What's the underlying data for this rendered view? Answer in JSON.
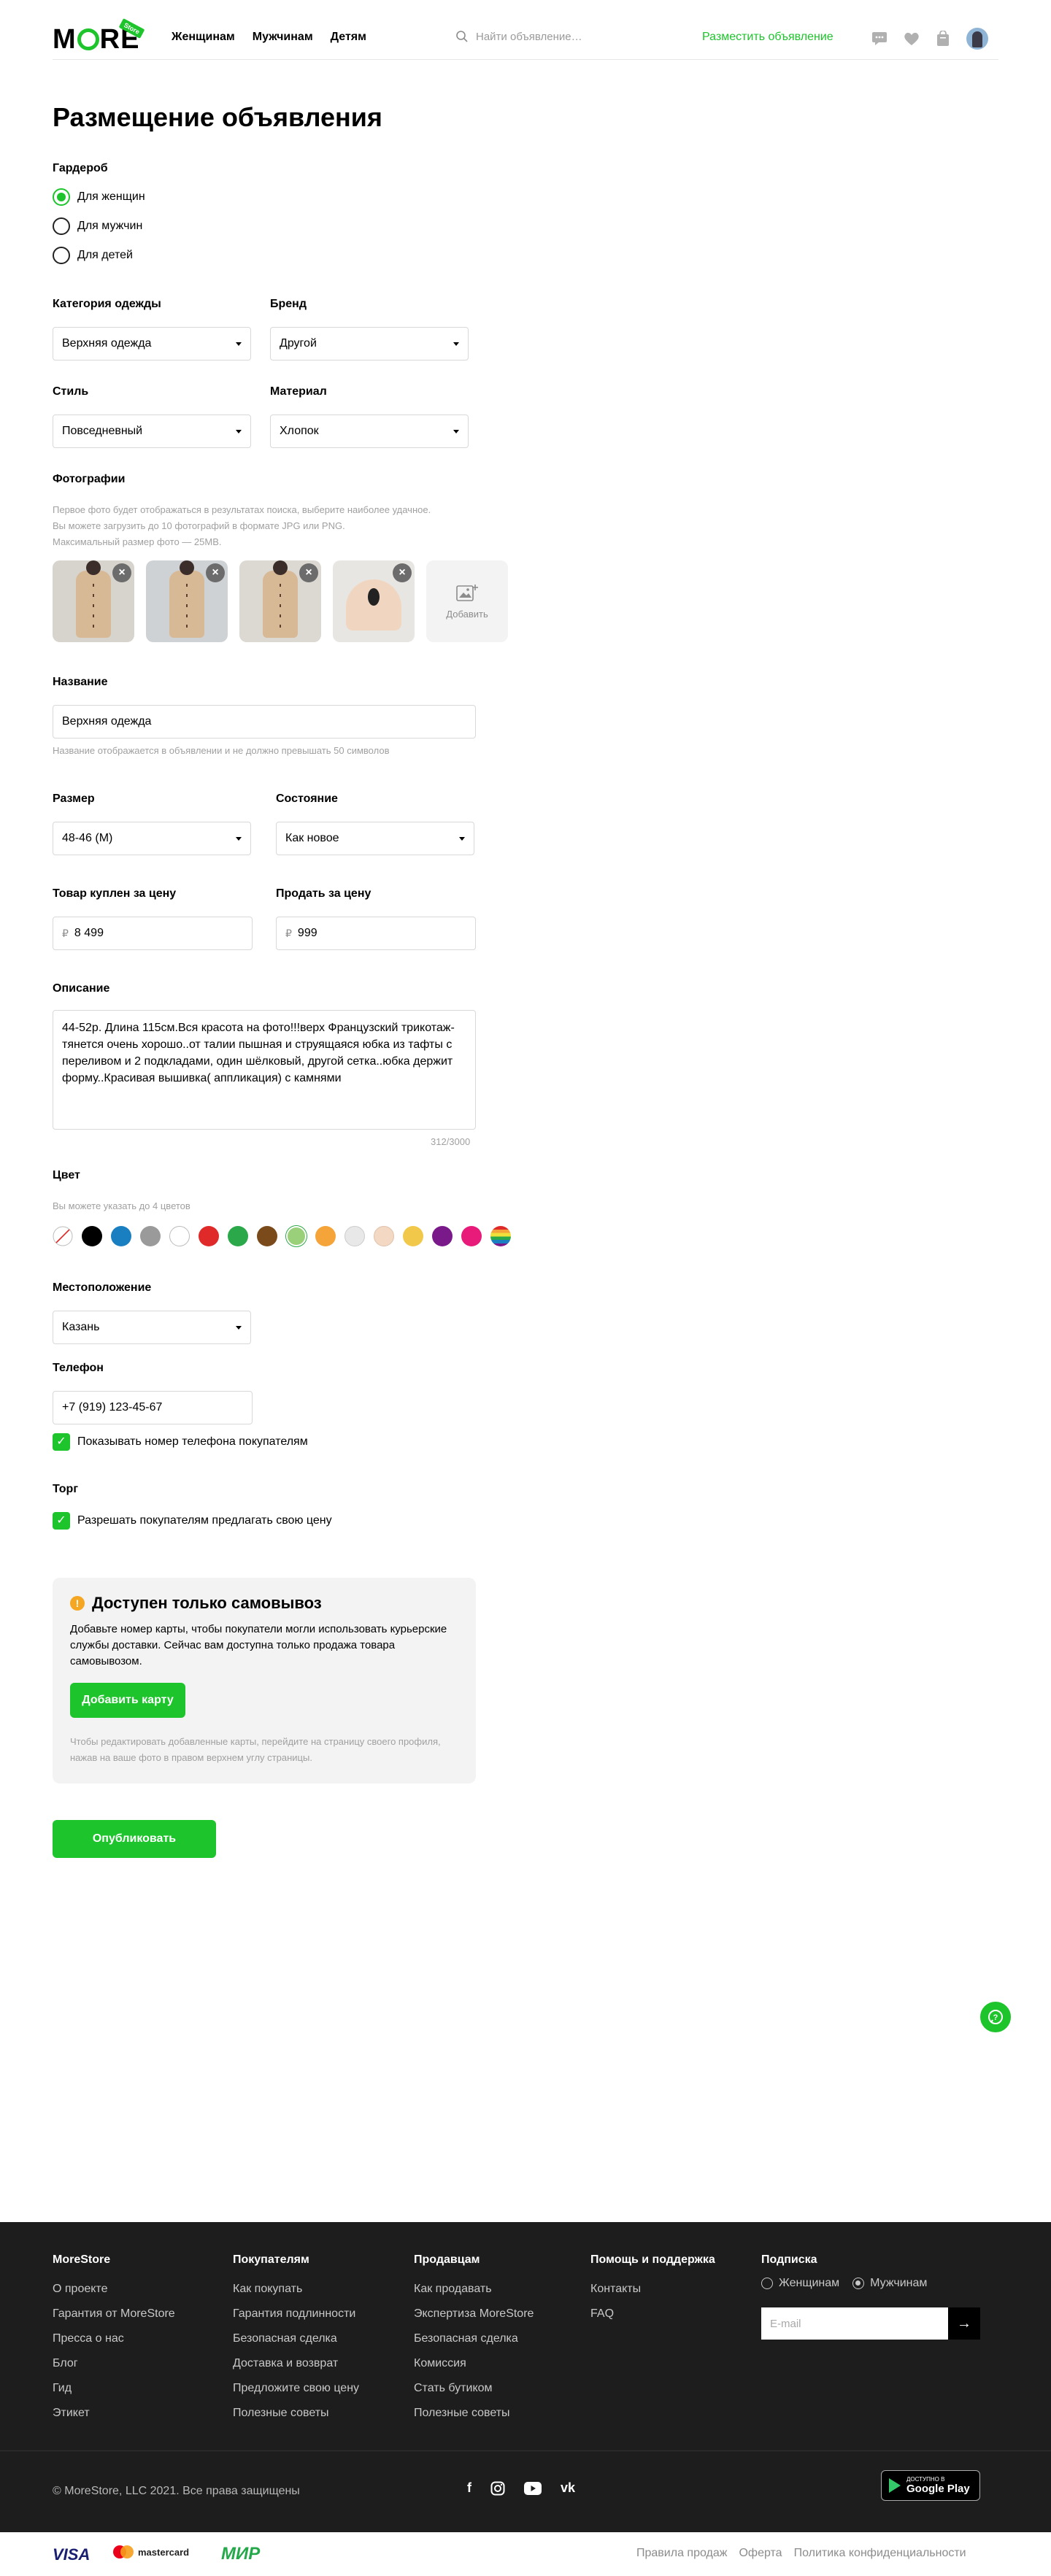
{
  "header": {
    "logo_text": "MORE",
    "logo_badge": "Store",
    "nav": [
      "Женщинам",
      "Мужчинам",
      "Детям"
    ],
    "search_placeholder": "Найти объявление…",
    "post_link": "Разместить объявление"
  },
  "form": {
    "title": "Размещение объявления",
    "wardrobe": {
      "label": "Гардероб",
      "options": [
        "Для женщин",
        "Для мужчин",
        "Для детей"
      ],
      "selected": "Для женщин"
    },
    "category": {
      "label": "Категория одежды",
      "value": "Верхняя одежда"
    },
    "brand": {
      "label": "Бренд",
      "value": "Другой"
    },
    "style": {
      "label": "Стиль",
      "value": "Повседневный"
    },
    "material": {
      "label": "Материал",
      "value": "Хлопок"
    },
    "photos": {
      "label": "Фотографии",
      "hint_lines": [
        "Первое фото будет отображаться в результатах поиска, выберите наиболее удачное.",
        "Вы можете загрузить до 10 фотографий в формате JPG или PNG.",
        "Максимальный размер фото — 25MB."
      ],
      "add_label": "Добавить"
    },
    "name": {
      "label": "Название",
      "value": "Верхняя одежда",
      "hint": "Название отображается в объявлении и не должно превышать 50 символов"
    },
    "size": {
      "label": "Размер",
      "value": "48-46 (M)"
    },
    "condition": {
      "label": "Состояние",
      "value": "Как новое"
    },
    "bought_price": {
      "label": "Товар куплен за цену",
      "currency": "₽",
      "value": "8 499"
    },
    "sell_price": {
      "label": "Продать за цену",
      "currency": "₽",
      "value": "999"
    },
    "description": {
      "label": "Описание",
      "value": "44-52р. Длина 115см.Вся красота на фото!!!верх Французский трикотаж- тянется очень хорошо..от талии пышная и струящаяся юбка из тафты с переливом и 2 подкладами, один шёлковый, другой сетка..юбка держит форму..Красивая вышивка( аппликация) с камнями",
      "counter": "312/3000"
    },
    "color": {
      "label": "Цвет",
      "hint": "Вы можете указать до 4 цветов",
      "swatches": [
        "#ffffff",
        "#000000",
        "#1a7fc1",
        "#9a9a9a",
        "#ffffff",
        "#e02a2a",
        "#2aa84a",
        "#7a4a1a",
        "#9ad07a",
        "#f5a43a",
        "#e8e8e8",
        "#f3d9c4",
        "#f2c84a",
        "#7a1a8a",
        "#e81a7a",
        "rainbow"
      ]
    },
    "location": {
      "label": "Местоположение",
      "value": "Казань"
    },
    "phone": {
      "label": "Телефон",
      "value": "+7 (919) 123-45-67",
      "show_label": "Показывать номер телефона покупателям"
    },
    "bargain": {
      "label": "Торг",
      "allow_label": "Разрешать  покупателям предлагать свою цену"
    },
    "pickup": {
      "title": "Доступен только самовывоз",
      "text": "Добавьте номер карты, чтобы покупатели могли использовать курьерские службы доставки. Сейчас вам доступна только продажа товара самовывозом.",
      "button": "Добавить карту",
      "hint": "Чтобы редактировать добавленные карты, перейдите на страницу своего профиля, нажав на ваше фото в правом верхнем углу страницы."
    },
    "publish_button": "Опубликовать"
  },
  "footer": {
    "columns": [
      {
        "title": "MoreStore",
        "links": [
          "О проекте",
          "Гарантия  от MoreStore",
          "Пресса о нас",
          "Блог",
          "Гид",
          "Этикет"
        ]
      },
      {
        "title": "Покупателям",
        "links": [
          "Как покупать",
          "Гарантия подлинности",
          "Безопасная сделка",
          "Доставка и возврат",
          "Предложите свою цену",
          "Полезные советы"
        ]
      },
      {
        "title": "Продавцам",
        "links": [
          "Как продавать",
          "Экспертиза MoreStore",
          "Безопасная сделка",
          "Комиссия",
          "Стать бутиком",
          "Полезные советы"
        ]
      },
      {
        "title": "Помощь и поддержка",
        "links": [
          "Контакты",
          "FAQ"
        ]
      }
    ],
    "subscribe": {
      "title": "Подписка",
      "options": [
        "Женщинам",
        "Мужчинам"
      ],
      "selected": "Мужчинам",
      "email_placeholder": "E-mail"
    },
    "copyright": "© MoreStore, LLC 2021. Все права защищены",
    "gplay_small": "ДОСТУПНО В",
    "gplay_big": "Google Play",
    "payments": [
      "VISA",
      "mastercard",
      "МИР"
    ],
    "bottom_links": [
      "Правила продаж",
      "Оферта",
      "Политика конфиденциальности"
    ]
  },
  "colors": {
    "accent": "#1dc42b",
    "footer_bg": "#1d1d1d",
    "warning": "#f5a623"
  }
}
